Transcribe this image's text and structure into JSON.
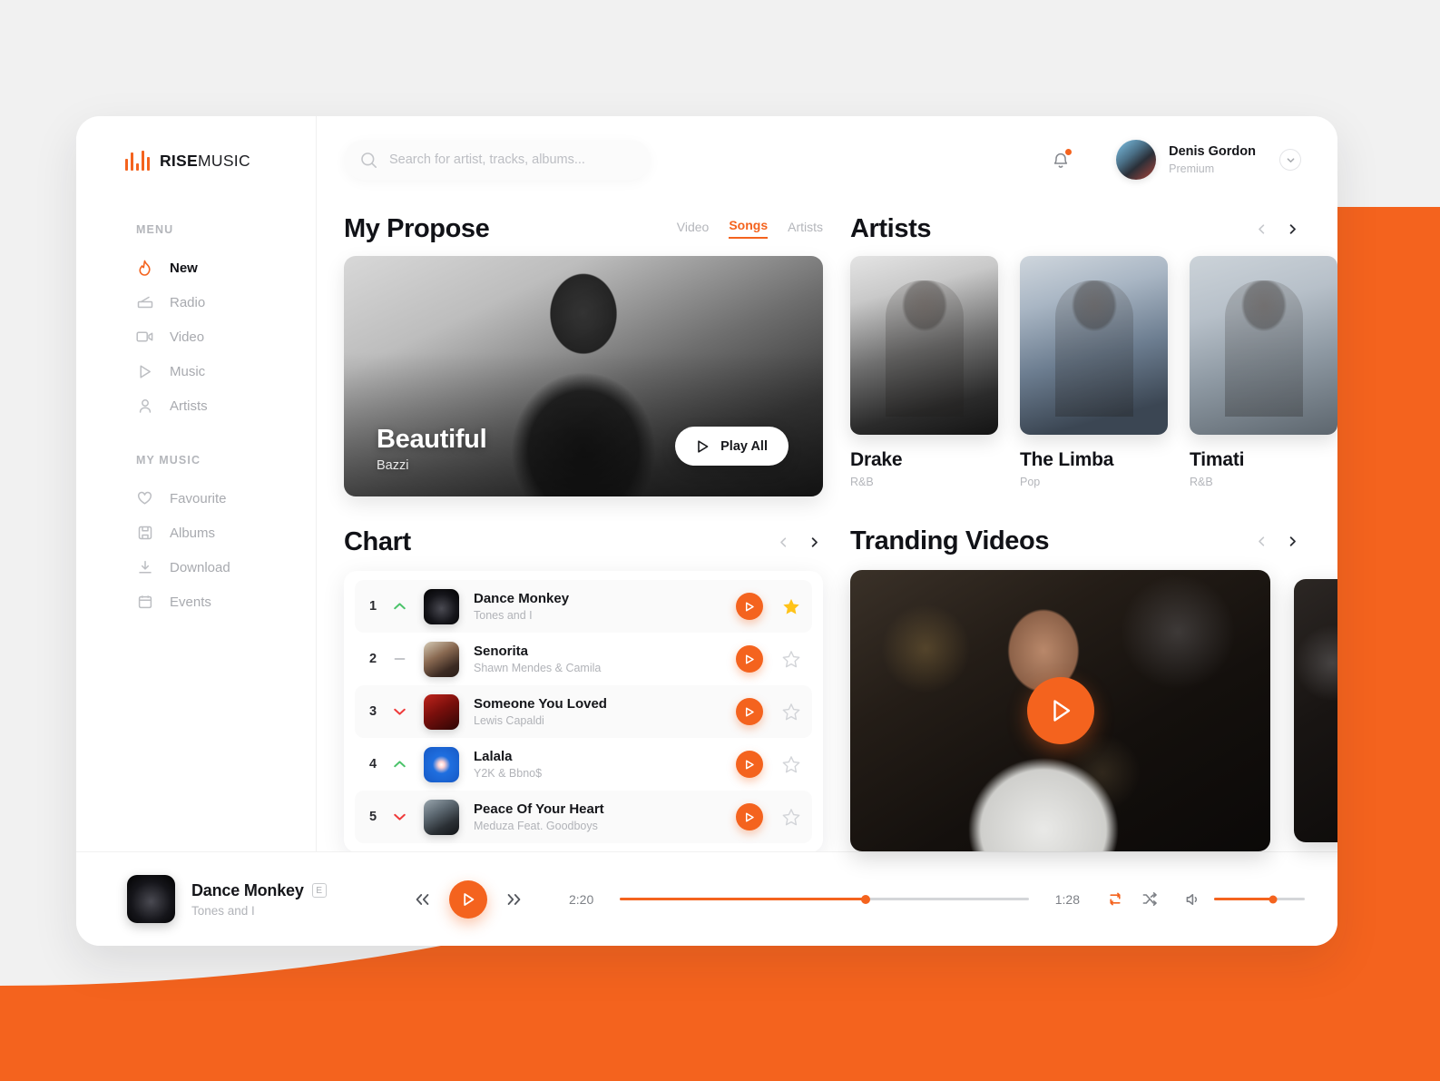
{
  "theme": {
    "accent": "#f4631e",
    "up": "#4cc36b",
    "down": "#ef3b3b",
    "star": "#ffc319"
  },
  "brand": {
    "name_bold": "RISE",
    "name_light": "MUSIC"
  },
  "search": {
    "placeholder": "Search for artist, tracks, albums...",
    "value": ""
  },
  "user": {
    "name": "Denis Gordon",
    "plan": "Premium"
  },
  "sidebar": {
    "menu_label": "MENU",
    "menu_items": [
      {
        "label": "New",
        "icon": "flame-icon",
        "active": true
      },
      {
        "label": "Radio",
        "icon": "radio-icon",
        "active": false
      },
      {
        "label": "Video",
        "icon": "video-camera-icon",
        "active": false
      },
      {
        "label": "Music",
        "icon": "play-outline-icon",
        "active": false
      },
      {
        "label": "Artists",
        "icon": "person-icon",
        "active": false
      }
    ],
    "mymusic_label": "MY MUSIC",
    "mymusic_items": [
      {
        "label": "Favourite",
        "icon": "heart-icon"
      },
      {
        "label": "Albums",
        "icon": "save-disk-icon"
      },
      {
        "label": "Download",
        "icon": "download-icon"
      },
      {
        "label": "Events",
        "icon": "calendar-icon"
      }
    ]
  },
  "propose": {
    "title": "My Propose",
    "tabs": [
      {
        "label": "Video",
        "active": false
      },
      {
        "label": "Songs",
        "active": true
      },
      {
        "label": "Artists",
        "active": false
      }
    ],
    "hero": {
      "title": "Beautiful",
      "artist": "Bazzi",
      "play_all": "Play All"
    }
  },
  "chart": {
    "title": "Chart",
    "rows": [
      {
        "rank": "1",
        "trend": "up",
        "title": "Dance Monkey",
        "artist": "Tones and I",
        "starred": true,
        "cover": "cv-dance"
      },
      {
        "rank": "2",
        "trend": "flat",
        "title": "Senorita",
        "artist": "Shawn Mendes & Camila",
        "starred": false,
        "cover": "cv-senorita"
      },
      {
        "rank": "3",
        "trend": "down",
        "title": "Someone You Loved",
        "artist": "Lewis Capaldi",
        "starred": false,
        "cover": "cv-someone"
      },
      {
        "rank": "4",
        "trend": "up",
        "title": "Lalala",
        "artist": "Y2K & Bbno$",
        "starred": false,
        "cover": "cv-lalala"
      },
      {
        "rank": "5",
        "trend": "down",
        "title": "Peace Of Your Heart",
        "artist": "Meduza Feat. Goodboys",
        "starred": false,
        "cover": "cv-peace"
      }
    ]
  },
  "artists": {
    "title": "Artists",
    "cards": [
      {
        "name": "Drake",
        "genre": "R&B",
        "img": "ai-drake"
      },
      {
        "name": "The Limba",
        "genre": "Pop",
        "img": "ai-limba"
      },
      {
        "name": "Timati",
        "genre": "R&B",
        "img": "ai-timati"
      }
    ]
  },
  "trending": {
    "title": "Tranding Videos"
  },
  "player": {
    "title": "Dance Monkey",
    "explicit_badge": "E",
    "artist": "Tones and I",
    "elapsed": "2:20",
    "remaining": "1:28",
    "progress_percent": 60,
    "volume_percent": 65,
    "repeat_on": true,
    "shuffle_on": false
  }
}
